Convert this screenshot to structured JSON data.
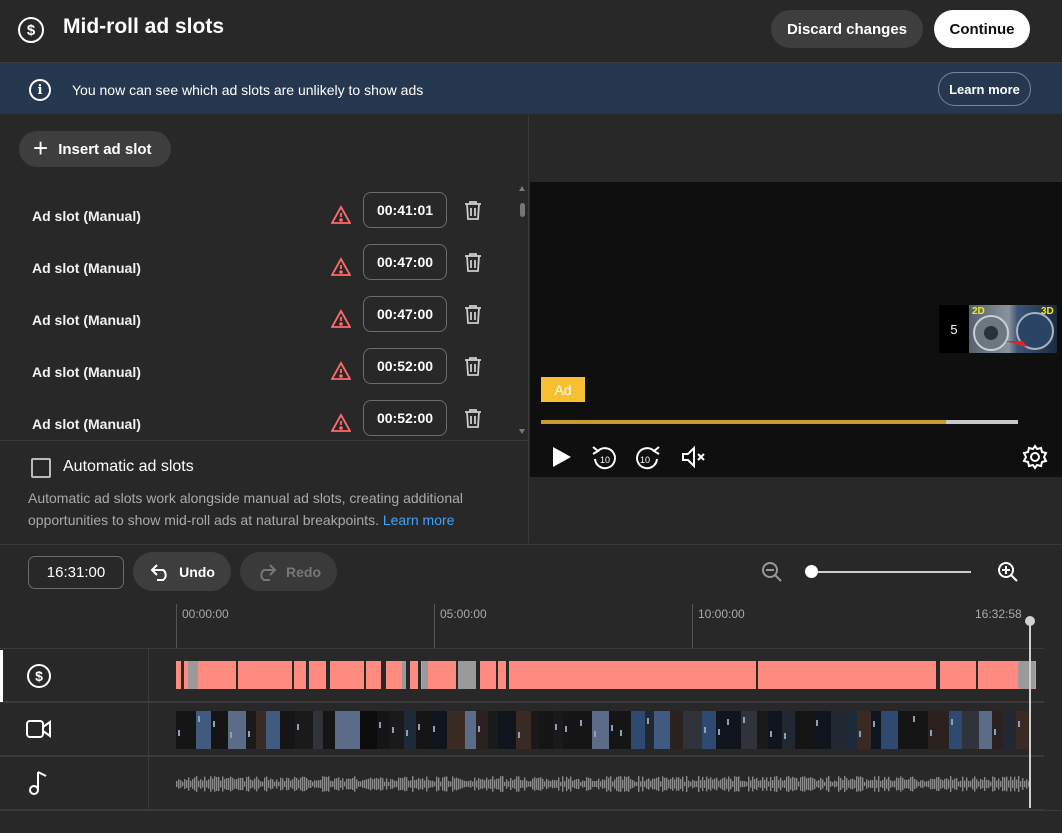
{
  "header": {
    "title": "Mid-roll ad slots",
    "discard_label": "Discard changes",
    "continue_label": "Continue"
  },
  "banner": {
    "message": "You now can see which ad slots are unlikely to show ads",
    "learn_more_label": "Learn more"
  },
  "slots_panel": {
    "insert_label": "Insert ad slot",
    "slots": [
      {
        "label": "Ad slot (Manual)",
        "time": "00:41:01"
      },
      {
        "label": "Ad slot (Manual)",
        "time": "00:47:00"
      },
      {
        "label": "Ad slot (Manual)",
        "time": "00:47:00"
      },
      {
        "label": "Ad slot (Manual)",
        "time": "00:52:00"
      },
      {
        "label": "Ad slot (Manual)",
        "time": "00:52:00"
      }
    ],
    "automatic": {
      "title": "Automatic ad slots",
      "checked": false,
      "description": "Automatic ad slots work alongside manual ad slots, creating additional opportunities to show mid-roll ads at natural breakpoints.",
      "learn_more": "Learn more"
    }
  },
  "player": {
    "ad_badge": "Ad",
    "countdown": "5",
    "thumb_tag_left": "2D",
    "thumb_tag_right": "3D",
    "progress_fraction": 0.85
  },
  "timeline": {
    "duration": "16:31:00",
    "undo_label": "Undo",
    "redo_label": "Redo",
    "ticks": [
      "00:00:00",
      "05:00:00",
      "10:00:00",
      "16:32:58"
    ]
  },
  "colors": {
    "accent_ad": "#f6c032",
    "progress": "#c79a2c",
    "ad_track": "#ff8a80",
    "link": "#3ea6ff",
    "banner_bg": "#263850",
    "warning": "#ff6b6b"
  },
  "icons": {
    "header": "dollar-circle-icon",
    "banner": "info-icon",
    "slot_warning": "warning-triangle-icon",
    "slot_delete": "trash-icon",
    "tracks": [
      "dollar-circle-icon",
      "video-camera-icon",
      "music-note-icon"
    ]
  }
}
